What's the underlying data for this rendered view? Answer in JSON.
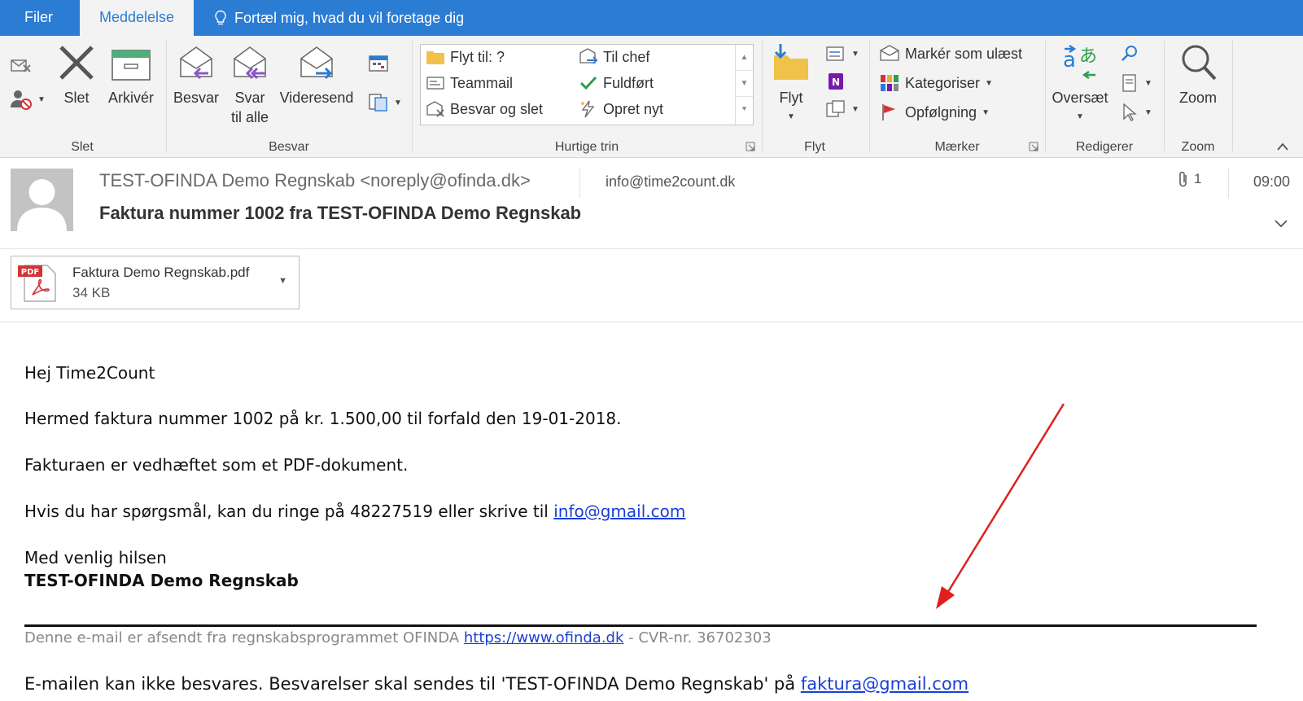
{
  "tabs": {
    "file": "Filer",
    "message": "Meddelelse",
    "tell_me": "Fortæl mig, hvad du vil foretage dig"
  },
  "ribbon": {
    "delete_group": {
      "label": "Slet",
      "delete": "Slet",
      "archive": "Arkivér"
    },
    "respond_group": {
      "label": "Besvar",
      "reply": "Besvar",
      "reply_all_line1": "Svar",
      "reply_all_line2": "til alle",
      "forward": "Videresend"
    },
    "quick_steps": {
      "label": "Hurtige trin",
      "items": [
        "Flyt til: ?",
        "Til chef",
        "Teammail",
        "Fuldført",
        "Besvar og slet",
        "Opret nyt"
      ]
    },
    "move_group": {
      "label": "Flyt",
      "move": "Flyt"
    },
    "tags_group": {
      "label": "Mærker",
      "mark_unread": "Markér som ulæst",
      "categorize": "Kategoriser",
      "follow_up": "Opfølgning"
    },
    "edit_group": {
      "label": "Redigerer",
      "translate": "Oversæt"
    },
    "zoom_group": {
      "label": "Zoom",
      "zoom": "Zoom"
    }
  },
  "message": {
    "sender": "TEST-OFINDA Demo Regnskab <noreply@ofinda.dk>",
    "recipient": "info@time2count.dk",
    "attachment_count": "1",
    "time": "09:00",
    "subject": "Faktura nummer 1002 fra TEST-OFINDA Demo Regnskab",
    "attachment": {
      "name": "Faktura Demo Regnskab.pdf",
      "size": "34 KB",
      "icon_label": "PDF"
    },
    "body": {
      "greeting": "Hej Time2Count",
      "line1": "Hermed faktura nummer 1002 på kr. 1.500,00 til forfald den 19-01-2018.",
      "line2": "Fakturaen er vedhæftet som et PDF-dokument.",
      "line3_prefix": "Hvis du har spørgsmål, kan du ringe på 48227519 eller skrive til ",
      "line3_link": "info@gmail.com",
      "closing": "Med venlig hilsen",
      "signature": "TEST-OFINDA Demo Regnskab",
      "footer_prefix": "Denne e-mail er afsendt fra regnskabsprogrammet OFINDA ",
      "footer_link": "https://www.ofinda.dk",
      "footer_suffix": " - CVR-nr. 36702303",
      "noreply_prefix": "E-mailen kan ikke besvares. Besvarelser skal sendes til 'TEST-OFINDA Demo Regnskab' på ",
      "noreply_link": "faktura@gmail.com"
    }
  },
  "colors": {
    "title_bar": "#2b7cd3",
    "ribbon_bg": "#f3f3f3",
    "link": "#1a3fd6",
    "annotation_arrow": "#e02020"
  }
}
